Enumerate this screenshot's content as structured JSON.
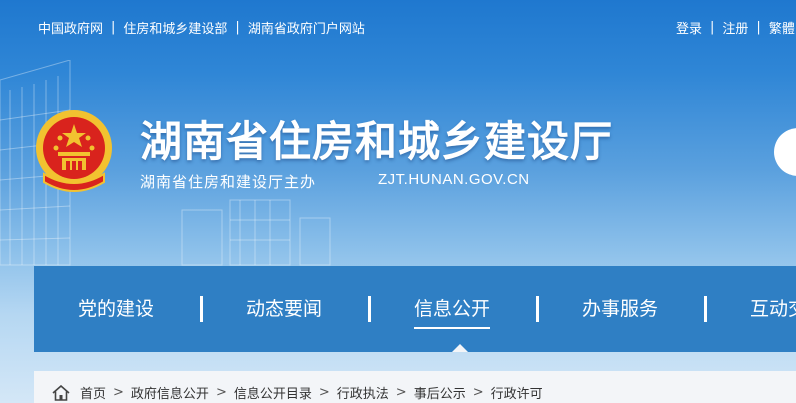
{
  "top_links": [
    "中国政府网",
    "住房和城乡建设部",
    "湖南省政府门户网站"
  ],
  "user_links": [
    "登录",
    "注册",
    "繁體"
  ],
  "site": {
    "title": "湖南省住房和城乡建设厅",
    "sponsor": "湖南省住房和建设厅主办",
    "domain": "ZJT.HUNAN.GOV.CN"
  },
  "nav": {
    "items": [
      "党的建设",
      "动态要闻",
      "信息公开",
      "办事服务",
      "互动交流"
    ],
    "active_index": 2
  },
  "breadcrumb": [
    "首页",
    "政府信息公开",
    "信息公开目录",
    "行政执法",
    "事后公示",
    "行政许可"
  ],
  "colors": {
    "nav_bg": "#2f7fc4",
    "banner_top": "#1f78cf",
    "emblem_red": "#d9231d",
    "emblem_gold": "#f2c230"
  },
  "icons": {
    "emblem": "national-emblem-icon",
    "home": "home-icon"
  }
}
